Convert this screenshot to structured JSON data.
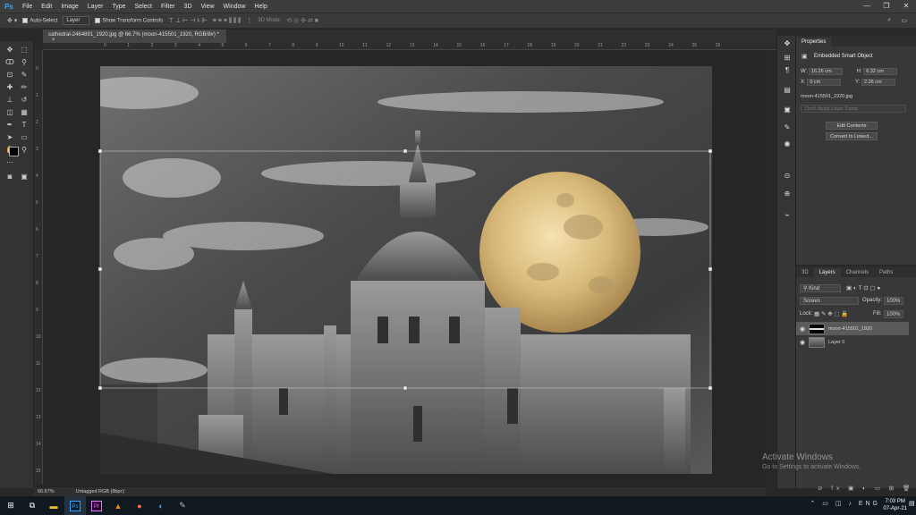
{
  "app": {
    "logo": "Ps"
  },
  "menubar": {
    "items": [
      "File",
      "Edit",
      "Image",
      "Layer",
      "Type",
      "Select",
      "Filter",
      "3D",
      "View",
      "Window",
      "Help"
    ]
  },
  "options_bar": {
    "auto_select_label": "Auto-Select",
    "auto_select_target": "Layer",
    "show_transform_label": "Show Transform Controls",
    "mode_3d_label": "3D Mode:"
  },
  "document": {
    "tab_title": "cathedral-2464891_1920.jpg @ 66.7% (moon-415501_1920, RGB/8#) *",
    "close_glyph": "×",
    "ruler_top_ticks": [
      "0",
      "1",
      "2",
      "3",
      "4",
      "5",
      "6",
      "7",
      "8",
      "9",
      "10",
      "11",
      "12",
      "13",
      "14",
      "15",
      "16",
      "17",
      "18",
      "19",
      "20",
      "21",
      "22",
      "23",
      "24",
      "25",
      "26"
    ],
    "ruler_left_ticks": [
      "0",
      "1",
      "2",
      "3",
      "4",
      "5",
      "6",
      "7",
      "8",
      "9",
      "10",
      "11",
      "12",
      "13",
      "14",
      "15"
    ]
  },
  "status": {
    "zoom": "66.67%",
    "color_profile": "Untagged RGB (8bpc)"
  },
  "properties": {
    "tab": "Properties",
    "object_type": "Embedded Smart Object",
    "w_label": "W:",
    "w_value": "16.26 cm",
    "h_label": "H:",
    "h_value": "6.32 cm",
    "x_label": "X:",
    "x_value": "0 cm",
    "y_label": "Y:",
    "y_value": "2.26 cm",
    "filename": "moon-415501_1920.jpg",
    "layer_comp": "Don't Apply Layer Comp",
    "edit_contents": "Edit Contents",
    "convert_linked": "Convert to Linked..."
  },
  "layers_panel": {
    "tabs": [
      "3D",
      "Layers",
      "Channels",
      "Paths"
    ],
    "active_tab": "Layers",
    "filter": "Kind",
    "blend_mode": "Screen",
    "opacity_label": "Opacity:",
    "opacity_value": "100%",
    "lock_label": "Lock:",
    "fill_label": "Fill:",
    "fill_value": "100%",
    "layers": [
      {
        "name": "moon-415501_1920",
        "selected": true
      },
      {
        "name": "Layer 0",
        "selected": false
      }
    ]
  },
  "watermark": {
    "title": "Activate Windows",
    "subtitle": "Go to Settings to activate Windows."
  },
  "taskbar": {
    "time": "7:03 PM",
    "date": "07-Apr-21"
  },
  "colors": {
    "accent": "#31a8ff",
    "selected_layer": "#5a5a5a",
    "panel": "#383838"
  }
}
